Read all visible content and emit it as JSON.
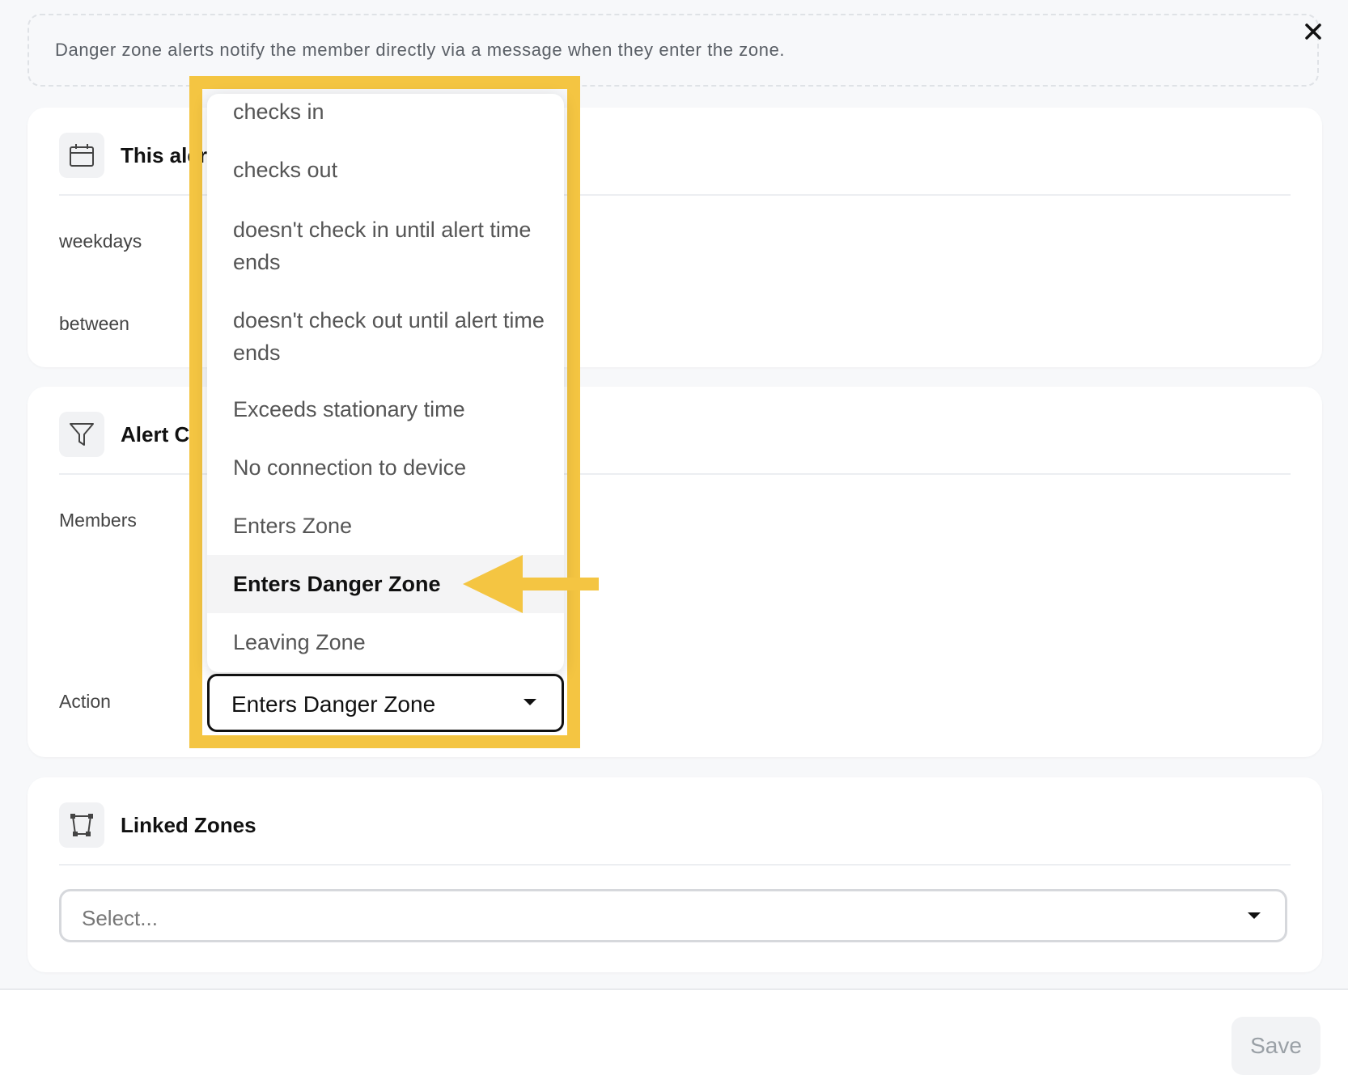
{
  "notice": {
    "text": "Danger zone alerts notify the member directly via a message when they enter the zone."
  },
  "schedule": {
    "title": "This alert",
    "rows": [
      "weekdays",
      "between"
    ]
  },
  "conditions": {
    "title": "Alert Co",
    "members_label": "Members",
    "action_label": "Action",
    "action_value": "Enters Danger Zone"
  },
  "dropdown": {
    "items": [
      "checks in",
      "checks out",
      "doesn't check in until alert time ends",
      "doesn't check out until alert time ends",
      "Exceeds stationary time",
      "No connection to device",
      "Enters Zone",
      "Enters Danger Zone",
      "Leaving Zone"
    ],
    "selected": "Enters Danger Zone"
  },
  "zones": {
    "title": "Linked Zones",
    "placeholder": "Select..."
  },
  "footer": {
    "save_label": "Save"
  },
  "colors": {
    "highlight": "#f4c542",
    "save_bg": "#f2f3f5"
  },
  "icons": {
    "close": "close-icon",
    "calendar": "calendar-icon",
    "filter": "filter-icon",
    "zones": "polygon-zone-icon",
    "caret": "chevron-down-icon"
  }
}
